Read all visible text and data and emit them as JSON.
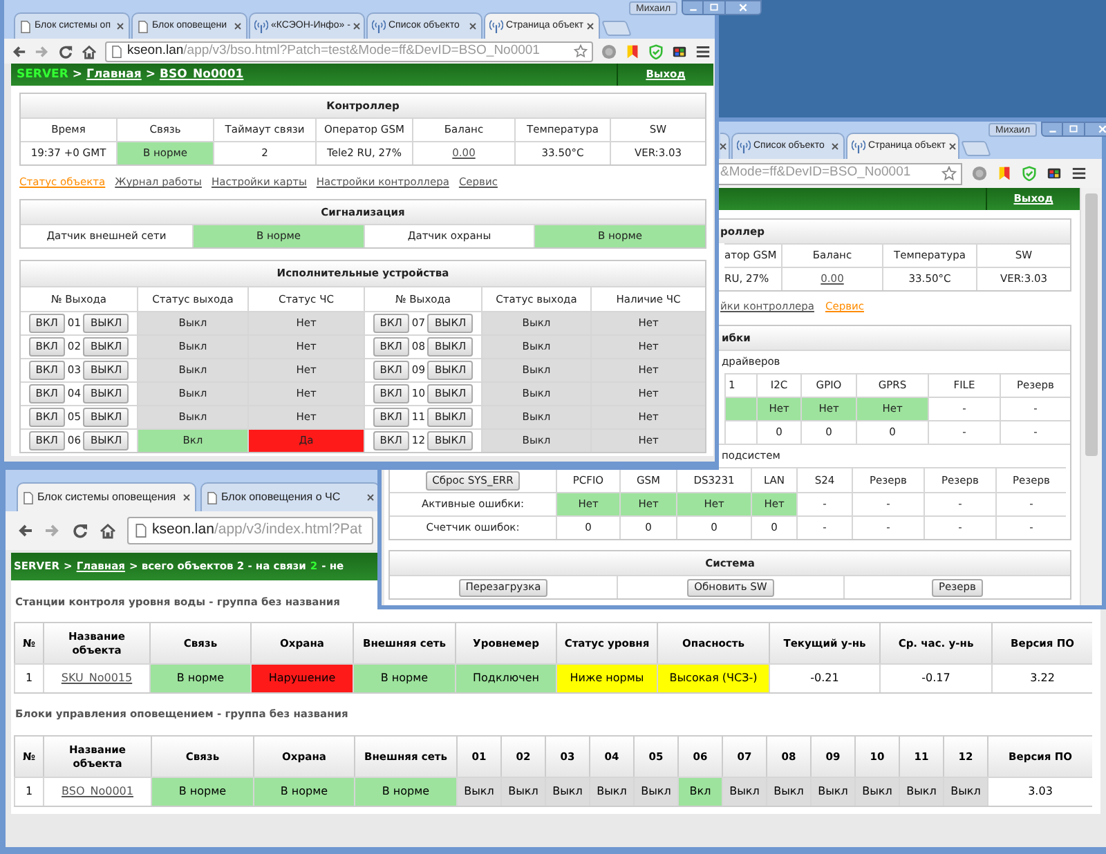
{
  "window_front": {
    "user": "Михаил",
    "tabs": [
      {
        "title": "Блок системы оп",
        "kind": "page",
        "selected": false
      },
      {
        "title": "Блок оповещени",
        "kind": "page",
        "selected": false
      },
      {
        "title": "«КСЭОН-Инфо» -",
        "kind": "site",
        "selected": false
      },
      {
        "title": "Список объекто",
        "kind": "site",
        "selected": false
      },
      {
        "title": "Страница объект",
        "kind": "site",
        "selected": true
      }
    ],
    "address": {
      "host": "kseon.lan",
      "path": "/app/v3/bso.html?Patch=test&Mode=ff&DevID=BSO_No0001"
    },
    "breadcrumb": [
      {
        "text": "SERVER",
        "kind": "root"
      },
      {
        "text": ">",
        "kind": "text"
      },
      {
        "text": "Главная",
        "kind": "link"
      },
      {
        "text": ">",
        "kind": "text"
      },
      {
        "text": "BSO_No0001",
        "kind": "link"
      }
    ],
    "logout": "Выход",
    "controller": {
      "title": "Контроллер",
      "columns": [
        "Время",
        "Связь",
        "Таймаут связи",
        "Оператор GSM",
        "Баланс",
        "Температура",
        "SW"
      ],
      "values": [
        {
          "text": "19:37 +0 GMT",
          "kind": "plain"
        },
        {
          "text": "В норме",
          "kind": "ok"
        },
        {
          "text": "2",
          "kind": "plain"
        },
        {
          "text": "Tele2 RU, 27%",
          "kind": "plain"
        },
        {
          "text": "0.00",
          "kind": "link"
        },
        {
          "text": "33.50°C",
          "kind": "plain"
        },
        {
          "text": "VER:3.03",
          "kind": "plain"
        }
      ]
    },
    "nav": [
      {
        "label": "Статус объекта",
        "selected": true
      },
      {
        "label": "Журнал работы",
        "selected": false
      },
      {
        "label": "Настройки карты",
        "selected": false
      },
      {
        "label": "Настройки контроллера",
        "selected": false
      },
      {
        "label": "Сервис",
        "selected": false
      }
    ],
    "alarms": {
      "title": "Сигнализация",
      "cells": [
        {
          "text": "Датчик внешней сети",
          "kind": "plain"
        },
        {
          "text": "В норме",
          "kind": "ok"
        },
        {
          "text": "Датчик охраны",
          "kind": "plain"
        },
        {
          "text": "В норме",
          "kind": "ok"
        }
      ]
    },
    "outputs": {
      "title": "Исполнительные устройства",
      "columns": [
        "№ Выхода",
        "Статус выхода",
        "Статус ЧС",
        "№ Выхода",
        "Статус выхода",
        "Наличие ЧС"
      ],
      "rows": [
        {
          "on": "ВКЛ",
          "number": "01",
          "off": "ВЫКЛ",
          "status": {
            "text": "Выкл",
            "kind": "off"
          },
          "emergency": {
            "text": "Нет",
            "kind": "off"
          }
        },
        {
          "on": "ВКЛ",
          "number": "02",
          "off": "ВЫКЛ",
          "status": {
            "text": "Выкл",
            "kind": "off"
          },
          "emergency": {
            "text": "Нет",
            "kind": "off"
          }
        },
        {
          "on": "ВКЛ",
          "number": "03",
          "off": "ВЫКЛ",
          "status": {
            "text": "Выкл",
            "kind": "off"
          },
          "emergency": {
            "text": "Нет",
            "kind": "off"
          }
        },
        {
          "on": "ВКЛ",
          "number": "04",
          "off": "ВЫКЛ",
          "status": {
            "text": "Выкл",
            "kind": "off"
          },
          "emergency": {
            "text": "Нет",
            "kind": "off"
          }
        },
        {
          "on": "ВКЛ",
          "number": "05",
          "off": "ВЫКЛ",
          "status": {
            "text": "Выкл",
            "kind": "off"
          },
          "emergency": {
            "text": "Нет",
            "kind": "off"
          }
        },
        {
          "on": "ВКЛ",
          "number": "06",
          "off": "ВЫКЛ",
          "status": {
            "text": "Вкл",
            "kind": "ok"
          },
          "emergency": {
            "text": "Да",
            "kind": "alarm"
          }
        },
        {
          "on": "ВКЛ",
          "number": "07",
          "off": "ВЫКЛ",
          "status": {
            "text": "Выкл",
            "kind": "off"
          },
          "emergency": {
            "text": "Нет",
            "kind": "off"
          }
        },
        {
          "on": "ВКЛ",
          "number": "08",
          "off": "ВЫКЛ",
          "status": {
            "text": "Выкл",
            "kind": "off"
          },
          "emergency": {
            "text": "Нет",
            "kind": "off"
          }
        },
        {
          "on": "ВКЛ",
          "number": "09",
          "off": "ВЫКЛ",
          "status": {
            "text": "Выкл",
            "kind": "off"
          },
          "emergency": {
            "text": "Нет",
            "kind": "off"
          }
        },
        {
          "on": "ВКЛ",
          "number": "10",
          "off": "ВЫКЛ",
          "status": {
            "text": "Выкл",
            "kind": "off"
          },
          "emergency": {
            "text": "Нет",
            "kind": "off"
          }
        },
        {
          "on": "ВКЛ",
          "number": "11",
          "off": "ВЫКЛ",
          "status": {
            "text": "Выкл",
            "kind": "off"
          },
          "emergency": {
            "text": "Нет",
            "kind": "off"
          }
        },
        {
          "on": "ВКЛ",
          "number": "12",
          "off": "ВЫКЛ",
          "status": {
            "text": "Выкл",
            "kind": "off"
          },
          "emergency": {
            "text": "Нет",
            "kind": "off"
          }
        }
      ]
    }
  },
  "window_middle": {
    "user": "Михаил",
    "tabs": [
      {
        "title": "Список объекто",
        "kind": "site",
        "selected": false
      },
      {
        "title": "Страница объект",
        "kind": "site",
        "selected": true
      }
    ],
    "address": {
      "path": "&Mode=ff&DevID=BSO_No0001"
    },
    "logout": "Выход",
    "controller": {
      "title": "роллер",
      "columns": [
        "атор GSM",
        "Баланс",
        "Температура",
        "SW"
      ],
      "values": [
        {
          "text": "RU, 27%",
          "kind": "plain"
        },
        {
          "text": "0.00",
          "kind": "link"
        },
        {
          "text": "33.50°C",
          "kind": "plain"
        },
        {
          "text": "VER:3.03",
          "kind": "plain"
        }
      ]
    },
    "nav": [
      {
        "label": "йки контроллера",
        "selected": false
      },
      {
        "label": "Сервис",
        "selected": true
      }
    ],
    "errors": {
      "title": "ибки",
      "drivers_caption": "драйверов",
      "driver_columns": [
        "1",
        "I2C",
        "GPIO",
        "GPRS",
        "FILE",
        "Резерв"
      ],
      "driver_rows": [
        [
          {
            "kind": "ok"
          },
          {
            "text": "Нет",
            "kind": "ok"
          },
          {
            "text": "Нет",
            "kind": "ok"
          },
          {
            "text": "Нет",
            "kind": "ok"
          },
          {
            "text": "-",
            "kind": "plain"
          },
          {
            "text": "-",
            "kind": "plain"
          }
        ],
        [
          {
            "kind": "plain"
          },
          {
            "text": "0",
            "kind": "plain"
          },
          {
            "text": "0",
            "kind": "plain"
          },
          {
            "text": "0",
            "kind": "plain"
          },
          {
            "text": "-",
            "kind": "plain"
          },
          {
            "text": "-",
            "kind": "plain"
          }
        ]
      ],
      "subsystems_caption": "подсистем",
      "reset_button": "Сброс SYS_ERR",
      "subsystem_columns": [
        "PCFIO",
        "GSM",
        "DS3231",
        "LAN",
        "S24",
        "Резерв",
        "Резерв",
        "Резерв"
      ],
      "subsystem_rows": [
        {
          "label": "Активные ошибки:",
          "cells": [
            {
              "text": "Нет",
              "kind": "ok"
            },
            {
              "text": "Нет",
              "kind": "ok"
            },
            {
              "text": "Нет",
              "kind": "ok"
            },
            {
              "text": "Нет",
              "kind": "ok"
            },
            {
              "text": "-",
              "kind": "plain"
            },
            {
              "text": "-",
              "kind": "plain"
            },
            {
              "text": "-",
              "kind": "plain"
            },
            {
              "text": "-",
              "kind": "plain"
            }
          ]
        },
        {
          "label": "Счетчик ошибок:",
          "cells": [
            {
              "text": "0",
              "kind": "plain"
            },
            {
              "text": "0",
              "kind": "plain"
            },
            {
              "text": "0",
              "kind": "plain"
            },
            {
              "text": "0",
              "kind": "plain"
            },
            {
              "text": "-",
              "kind": "plain"
            },
            {
              "text": "-",
              "kind": "plain"
            },
            {
              "text": "-",
              "kind": "plain"
            },
            {
              "text": "-",
              "kind": "plain"
            }
          ]
        }
      ]
    },
    "system": {
      "title": "Система",
      "buttons": [
        "Перезагрузка",
        "Обновить SW",
        "Резерв"
      ]
    }
  },
  "window_back": {
    "tabs": [
      {
        "title": "Блок системы оповещения",
        "kind": "page",
        "selected": true
      },
      {
        "title": "Блок оповещения о ЧС",
        "kind": "page",
        "selected": false
      }
    ],
    "address": {
      "host": "kseon.lan",
      "path": "/app/v3/index.html?Pat"
    },
    "breadcrumb": [
      {
        "text": "SERVER",
        "kind": "text"
      },
      {
        "text": ">",
        "kind": "text"
      },
      {
        "text": "Главная",
        "kind": "link"
      },
      {
        "text": "> всего объектов 2 - на связи",
        "kind": "text"
      },
      {
        "text": "2",
        "kind": "count"
      },
      {
        "text": "- не",
        "kind": "text"
      }
    ],
    "groups": [
      {
        "title": "Станции контроля уровня воды - группа без названия",
        "columns": [
          "№",
          "Название объекта",
          "Связь",
          "Охрана",
          "Внешняя сеть",
          "Уровнемер",
          "Статус уровня",
          "Опасность",
          "Текущий у-нь",
          "Ср. час. у-нь",
          "Версия ПО"
        ],
        "rows": [
          [
            {
              "text": "1",
              "kind": "plain"
            },
            {
              "text": "SKU_No0015",
              "kind": "link"
            },
            {
              "text": "В норме",
              "kind": "ok"
            },
            {
              "text": "Нарушение",
              "kind": "alarm"
            },
            {
              "text": "В норме",
              "kind": "ok"
            },
            {
              "text": "Подключен",
              "kind": "ok"
            },
            {
              "text": "Ниже нормы",
              "kind": "warn"
            },
            {
              "text": "Высокая (ЧСЗ-)",
              "kind": "warn"
            },
            {
              "text": "-0.21",
              "kind": "plain"
            },
            {
              "text": "-0.17",
              "kind": "plain"
            },
            {
              "text": "3.22",
              "kind": "plain"
            }
          ]
        ]
      },
      {
        "title": "Блоки управления оповещением - группа без названия",
        "columns": [
          "№",
          "Название объекта",
          "Связь",
          "Охрана",
          "Внешняя сеть",
          "01",
          "02",
          "03",
          "04",
          "05",
          "06",
          "07",
          "08",
          "09",
          "10",
          "11",
          "12",
          "Версия ПО"
        ],
        "rows": [
          [
            {
              "text": "1",
              "kind": "plain"
            },
            {
              "text": "BSO_No0001",
              "kind": "link"
            },
            {
              "text": "В норме",
              "kind": "ok"
            },
            {
              "text": "В норме",
              "kind": "ok"
            },
            {
              "text": "В норме",
              "kind": "ok"
            },
            {
              "text": "Выкл",
              "kind": "off"
            },
            {
              "text": "Выкл",
              "kind": "off"
            },
            {
              "text": "Выкл",
              "kind": "off"
            },
            {
              "text": "Выкл",
              "kind": "off"
            },
            {
              "text": "Выкл",
              "kind": "off"
            },
            {
              "text": "Вкл",
              "kind": "ok"
            },
            {
              "text": "Выкл",
              "kind": "off"
            },
            {
              "text": "Выкл",
              "kind": "off"
            },
            {
              "text": "Выкл",
              "kind": "off"
            },
            {
              "text": "Выкл",
              "kind": "off"
            },
            {
              "text": "Выкл",
              "kind": "off"
            },
            {
              "text": "Выкл",
              "kind": "off"
            },
            {
              "text": "3.03",
              "kind": "plain"
            }
          ]
        ]
      }
    ]
  }
}
